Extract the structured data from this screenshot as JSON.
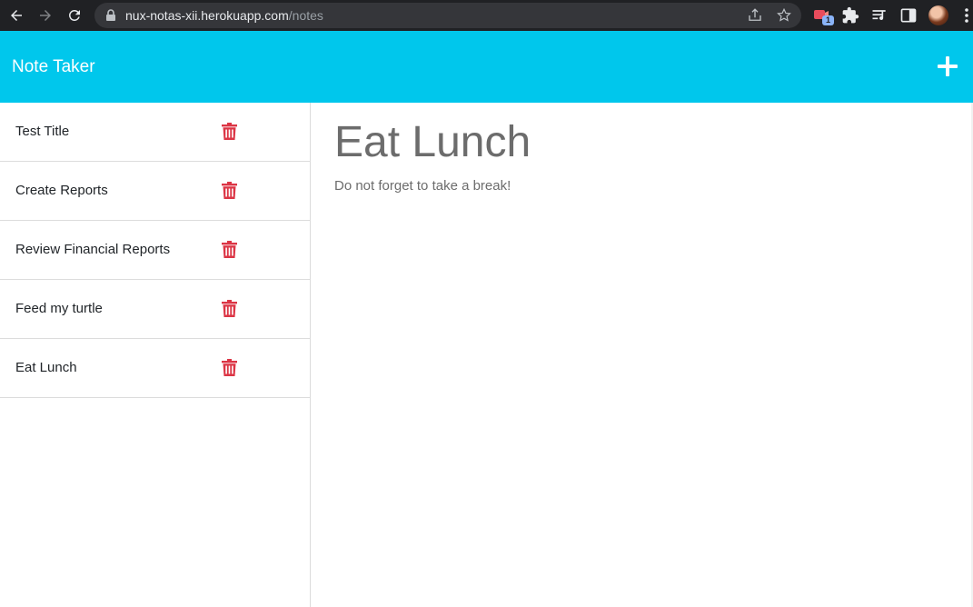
{
  "browser": {
    "url_host": "nux-notas-xii.herokuapp.com",
    "url_path": "/notes",
    "extension_badge": "1"
  },
  "app": {
    "brand": "Note Taker",
    "accent_color": "#00c7ec",
    "delete_color": "#dc3545"
  },
  "notes": [
    {
      "title": "Test Title"
    },
    {
      "title": "Create Reports"
    },
    {
      "title": "Review Financial Reports"
    },
    {
      "title": "Feed my turtle"
    },
    {
      "title": "Eat Lunch"
    }
  ],
  "active_note": {
    "title": "Eat Lunch",
    "text": "Do not forget to take a break!"
  }
}
